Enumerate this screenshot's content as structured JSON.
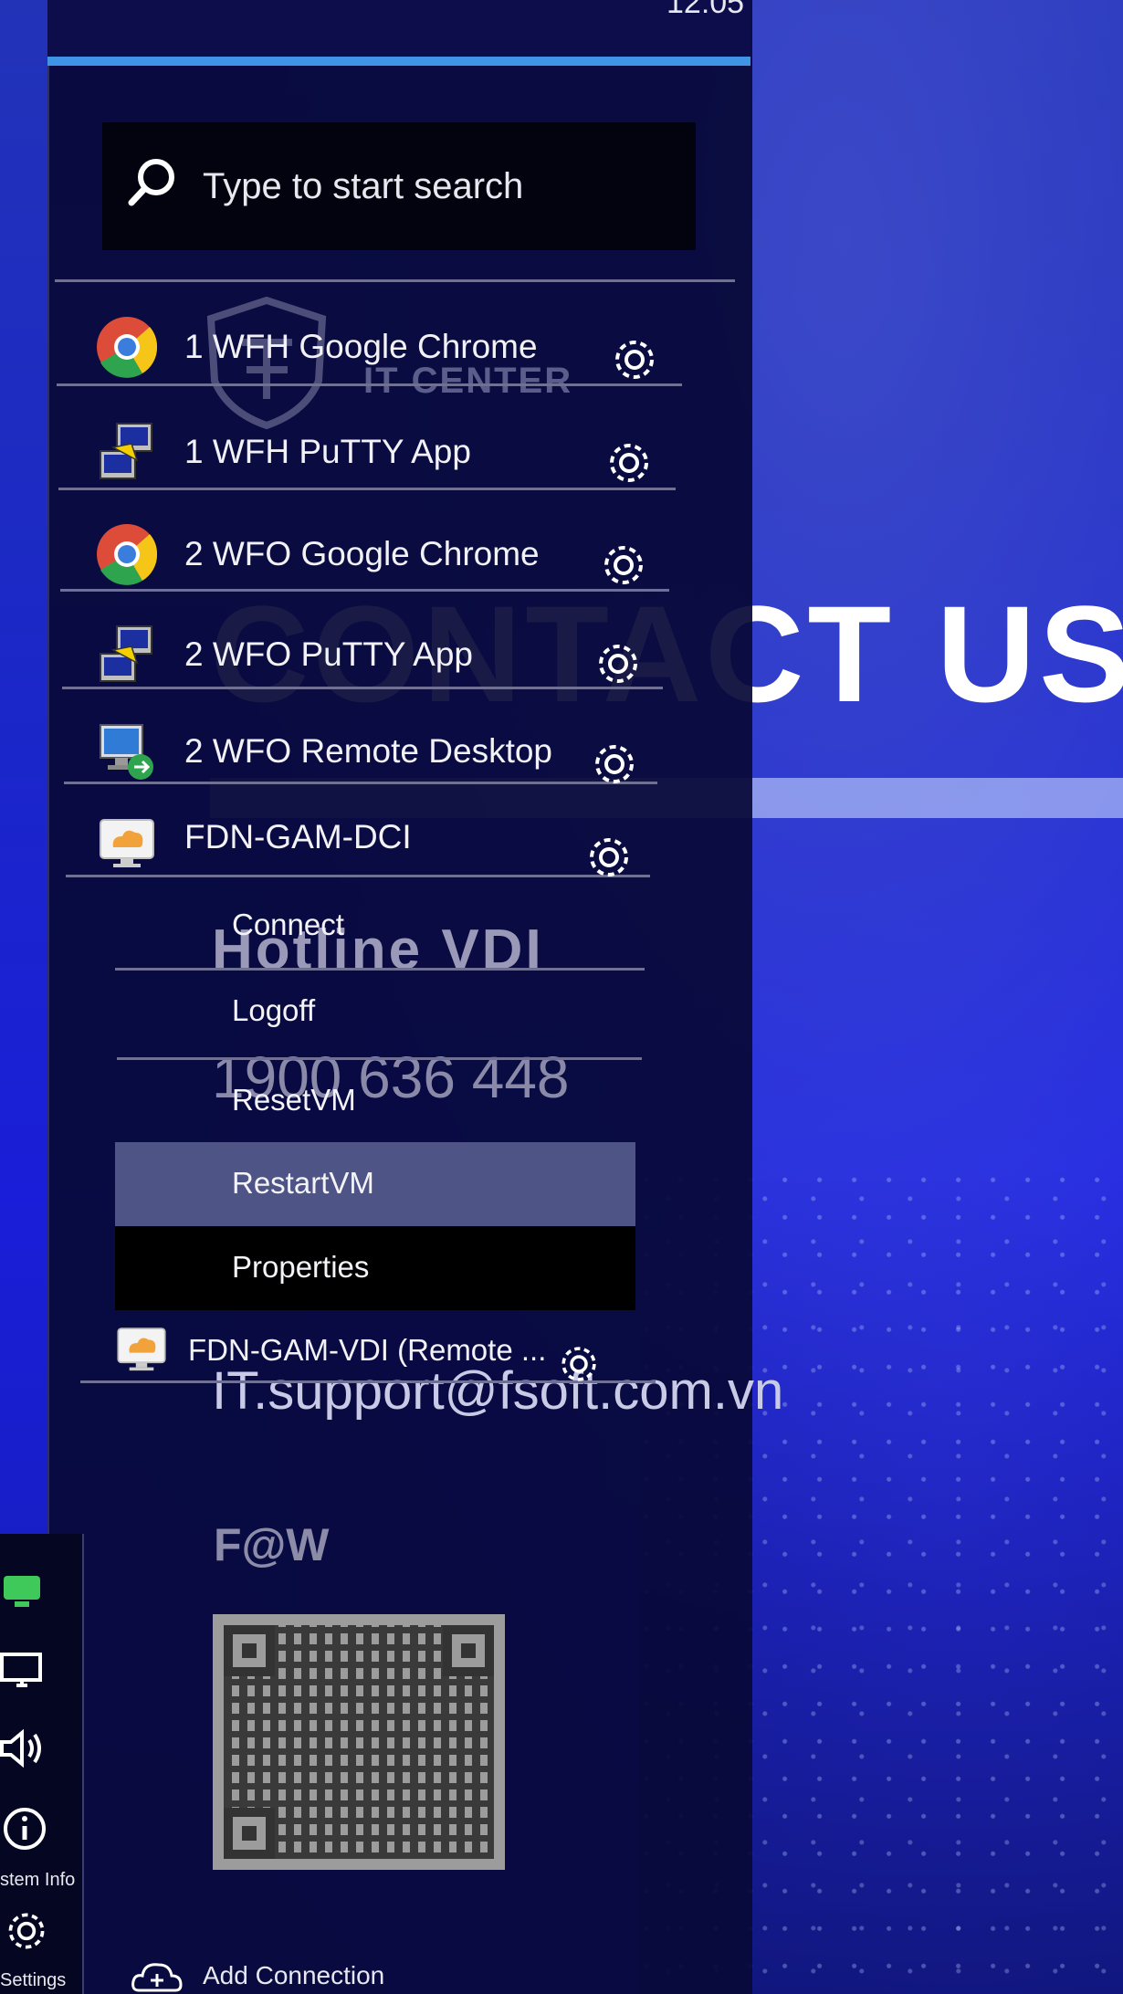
{
  "clock": "12:05",
  "search": {
    "placeholder": "Type to start search"
  },
  "apps": [
    {
      "label": "1 WFH Google Chrome",
      "icon": "chrome-icon"
    },
    {
      "label": "1 WFH PuTTY App",
      "icon": "putty-icon"
    },
    {
      "label": "2 WFO Google Chrome",
      "icon": "chrome-icon"
    },
    {
      "label": "2 WFO PuTTY App",
      "icon": "putty-icon"
    },
    {
      "label": "2 WFO Remote Desktop",
      "icon": "remote-desktop-icon"
    },
    {
      "label": "FDN-GAM-DCI",
      "icon": "vdi-icon"
    }
  ],
  "context_menu": [
    "Connect",
    "Logoff",
    "ResetVM",
    "RestartVM",
    "Properties"
  ],
  "last_app": {
    "label": "FDN-GAM-VDI (Remote ...",
    "icon": "vdi-icon"
  },
  "sidebar": {
    "system_info_label": "stem Info",
    "settings_label": "Settings"
  },
  "add_connection": "Add Connection",
  "watermark": "IT CENTER",
  "poster": {
    "title": "CONTACT US",
    "hotline": "Hotline VDI",
    "phone": "1900 636 448",
    "email": "IT.support@fsoft.com.vn",
    "faw": "F@W"
  },
  "colors": {
    "accent": "#3f94e6",
    "panel": "#08093a",
    "hover": "#4f5487"
  }
}
